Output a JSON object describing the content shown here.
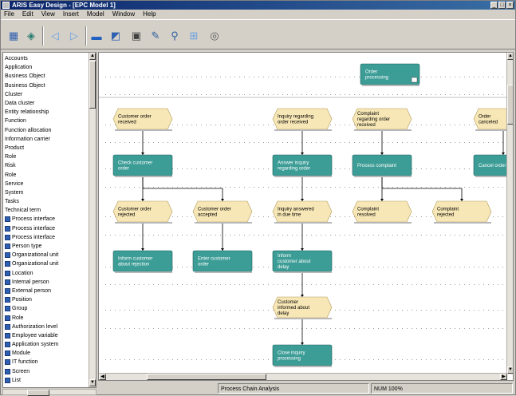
{
  "window": {
    "title": "ARIS Easy Design - [EPC Model 1]",
    "minimize_glyph": "_",
    "maximize_glyph": "□",
    "close_glyph": "×"
  },
  "menu": [
    "File",
    "Edit",
    "View",
    "Insert",
    "Model",
    "Window",
    "Help"
  ],
  "toolbar": {
    "buttons": [
      {
        "name": "properties-icon",
        "glyph": "▦"
      },
      {
        "name": "model-icon",
        "glyph": "◈"
      },
      {
        "name": "back-icon",
        "glyph": "◁"
      },
      {
        "name": "forward-icon",
        "glyph": "▷"
      },
      {
        "name": "open-folder-icon",
        "glyph": "▬"
      },
      {
        "name": "save-icon",
        "glyph": "◩"
      },
      {
        "name": "print-icon",
        "glyph": "▣"
      },
      {
        "name": "edit-icon",
        "glyph": "✎"
      },
      {
        "name": "search-icon",
        "glyph": "⚲"
      },
      {
        "name": "layout-icon",
        "glyph": "⊞"
      },
      {
        "name": "zoom-icon",
        "glyph": "◎"
      }
    ]
  },
  "sidebar": {
    "items": [
      {
        "label": "Accounts",
        "icon": false
      },
      {
        "label": "Application",
        "icon": false
      },
      {
        "label": "Business Object",
        "icon": false
      },
      {
        "label": "Business Object",
        "icon": false
      },
      {
        "label": "Cluster",
        "icon": false
      },
      {
        "label": "Data cluster",
        "icon": false
      },
      {
        "label": "Entity relationship",
        "icon": false
      },
      {
        "label": "Function",
        "icon": false
      },
      {
        "label": "Function allocation",
        "icon": false
      },
      {
        "label": "Information carrier",
        "icon": false
      },
      {
        "label": "Product",
        "icon": false
      },
      {
        "label": "Role",
        "icon": false
      },
      {
        "label": "Risk",
        "icon": false
      },
      {
        "label": "Role",
        "icon": false
      },
      {
        "label": "Service",
        "icon": false
      },
      {
        "label": "System",
        "icon": false
      },
      {
        "label": "Tasks",
        "icon": false
      },
      {
        "label": "Technical term",
        "icon": false
      },
      {
        "label": "Process interface",
        "icon": true
      },
      {
        "label": "Process interface",
        "icon": true
      },
      {
        "label": "Process interface",
        "icon": true
      },
      {
        "label": "Person type",
        "icon": true
      },
      {
        "label": "Organizational unit",
        "icon": true
      },
      {
        "label": "Organizational unit",
        "icon": true
      },
      {
        "label": "Location",
        "icon": true
      },
      {
        "label": "Internal person",
        "icon": true
      },
      {
        "label": "External person",
        "icon": true
      },
      {
        "label": "Position",
        "icon": true
      },
      {
        "label": "Group",
        "icon": true
      },
      {
        "label": "Role",
        "icon": true
      },
      {
        "label": "Authorization level",
        "icon": true
      },
      {
        "label": "Employee variable",
        "icon": true
      },
      {
        "label": "Application system",
        "icon": true
      },
      {
        "label": "Module",
        "icon": true
      },
      {
        "label": "IT function",
        "icon": true
      },
      {
        "label": "Screen",
        "icon": true
      },
      {
        "label": "List",
        "icon": true
      }
    ]
  },
  "diagram": {
    "nodes": [
      {
        "id": "n1",
        "type": "function",
        "label": "Order\nprocessing",
        "col": 4,
        "row": 0
      },
      {
        "id": "n2",
        "type": "event",
        "label": "Customer order\nreceived",
        "col": 0,
        "row": 1
      },
      {
        "id": "n3",
        "type": "event",
        "label": "Inquiry regarding\norder received",
        "col": 2,
        "row": 1
      },
      {
        "id": "n4",
        "type": "event",
        "label": "Complaint\nregarding order\nreceived",
        "col": 3,
        "row": 1
      },
      {
        "id": "n5",
        "type": "event",
        "label": "Order\ncanceled",
        "col": 5,
        "row": 1
      },
      {
        "id": "n6",
        "type": "function",
        "label": "Check customer\norder",
        "col": 0,
        "row": 2
      },
      {
        "id": "n7",
        "type": "function",
        "label": "Answer inquiry\nregarding order",
        "col": 2,
        "row": 2
      },
      {
        "id": "n8",
        "type": "function",
        "label": "Process complaint",
        "col": 3,
        "row": 2
      },
      {
        "id": "n9",
        "type": "function",
        "label": "Cancel order",
        "col": 5,
        "row": 2
      },
      {
        "id": "n10",
        "type": "event",
        "label": "Customer order\nrejected",
        "col": 0,
        "row": 3
      },
      {
        "id": "n11",
        "type": "event",
        "label": "Customer order\naccepted",
        "col": 1,
        "row": 3
      },
      {
        "id": "n12",
        "type": "event",
        "label": "Inquiry answered\nin due time",
        "col": 2,
        "row": 3
      },
      {
        "id": "n13",
        "type": "event",
        "label": "Complaint\nresolved",
        "col": 3,
        "row": 3
      },
      {
        "id": "n14",
        "type": "event",
        "label": "Complaint\nrejected",
        "col": 4,
        "row": 3
      },
      {
        "id": "n15",
        "type": "function",
        "label": "Inform customer\nabout rejection",
        "col": 0,
        "row": 4
      },
      {
        "id": "n16",
        "type": "function",
        "label": "Enter customer\norder",
        "col": 1,
        "row": 4
      },
      {
        "id": "n17",
        "type": "function",
        "label": "Inform\ncustomer about\ndelay",
        "col": 2,
        "row": 4
      },
      {
        "id": "n18",
        "type": "event",
        "label": "Customer\ninformed about\ndelay",
        "col": 2,
        "row": 5
      },
      {
        "id": "n19",
        "type": "function",
        "label": "Close inquiry\nprocessing",
        "col": 2,
        "row": 6
      }
    ],
    "edges": [
      [
        "n2",
        "n6"
      ],
      [
        "n3",
        "n7"
      ],
      [
        "n4",
        "n8"
      ],
      [
        "n5",
        "n9"
      ],
      [
        "n6",
        "n10"
      ],
      [
        "n6",
        "n11"
      ],
      [
        "n7",
        "n12"
      ],
      [
        "n8",
        "n13"
      ],
      [
        "n8",
        "n14"
      ],
      [
        "n10",
        "n15"
      ],
      [
        "n11",
        "n16"
      ],
      [
        "n12",
        "n17"
      ],
      [
        "n17",
        "n18"
      ],
      [
        "n18",
        "n19"
      ]
    ],
    "colors": {
      "function": "#3c9c96",
      "function_text": "#ffffff",
      "event": "#f7e7b6",
      "event_text": "#000000",
      "grid_dot": "#9a9a9a",
      "line": "#000000"
    }
  },
  "status": {
    "left": "Process Chain Analysis",
    "right": "NUM   100%"
  }
}
